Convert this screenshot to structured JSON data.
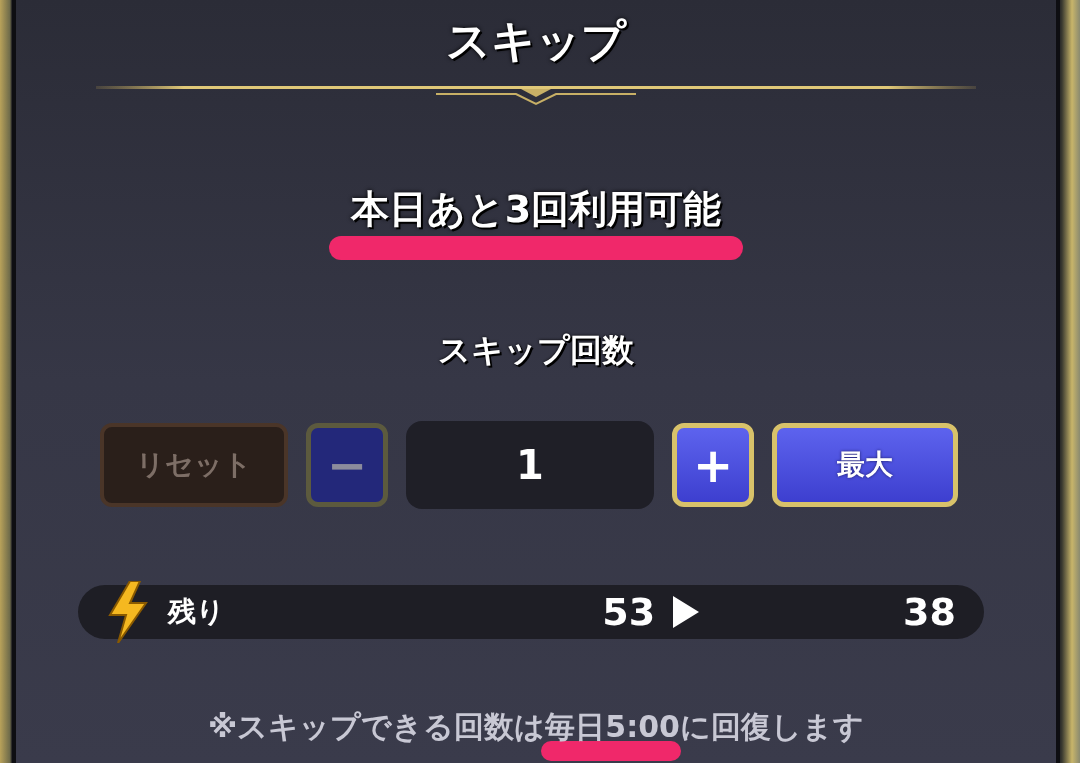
{
  "dialog": {
    "title": "スキップ"
  },
  "remaining_uses": {
    "text": "本日あと3回利用可能",
    "highlighted": true
  },
  "skip_count": {
    "label": "スキップ回数",
    "value": "1"
  },
  "buttons": [
    {
      "kind": "reset",
      "label": "リセット",
      "disabled": true
    },
    {
      "kind": "minus",
      "label": "−",
      "disabled": true
    },
    {
      "kind": "plus",
      "label": "+",
      "disabled": false
    },
    {
      "kind": "max",
      "label": "最大",
      "disabled": false
    }
  ],
  "stamina": {
    "label": "残り",
    "current": "53",
    "after": "38"
  },
  "footnote": {
    "text": "※スキップできる回数は毎日5:00に回復します",
    "highlighted": true
  }
}
